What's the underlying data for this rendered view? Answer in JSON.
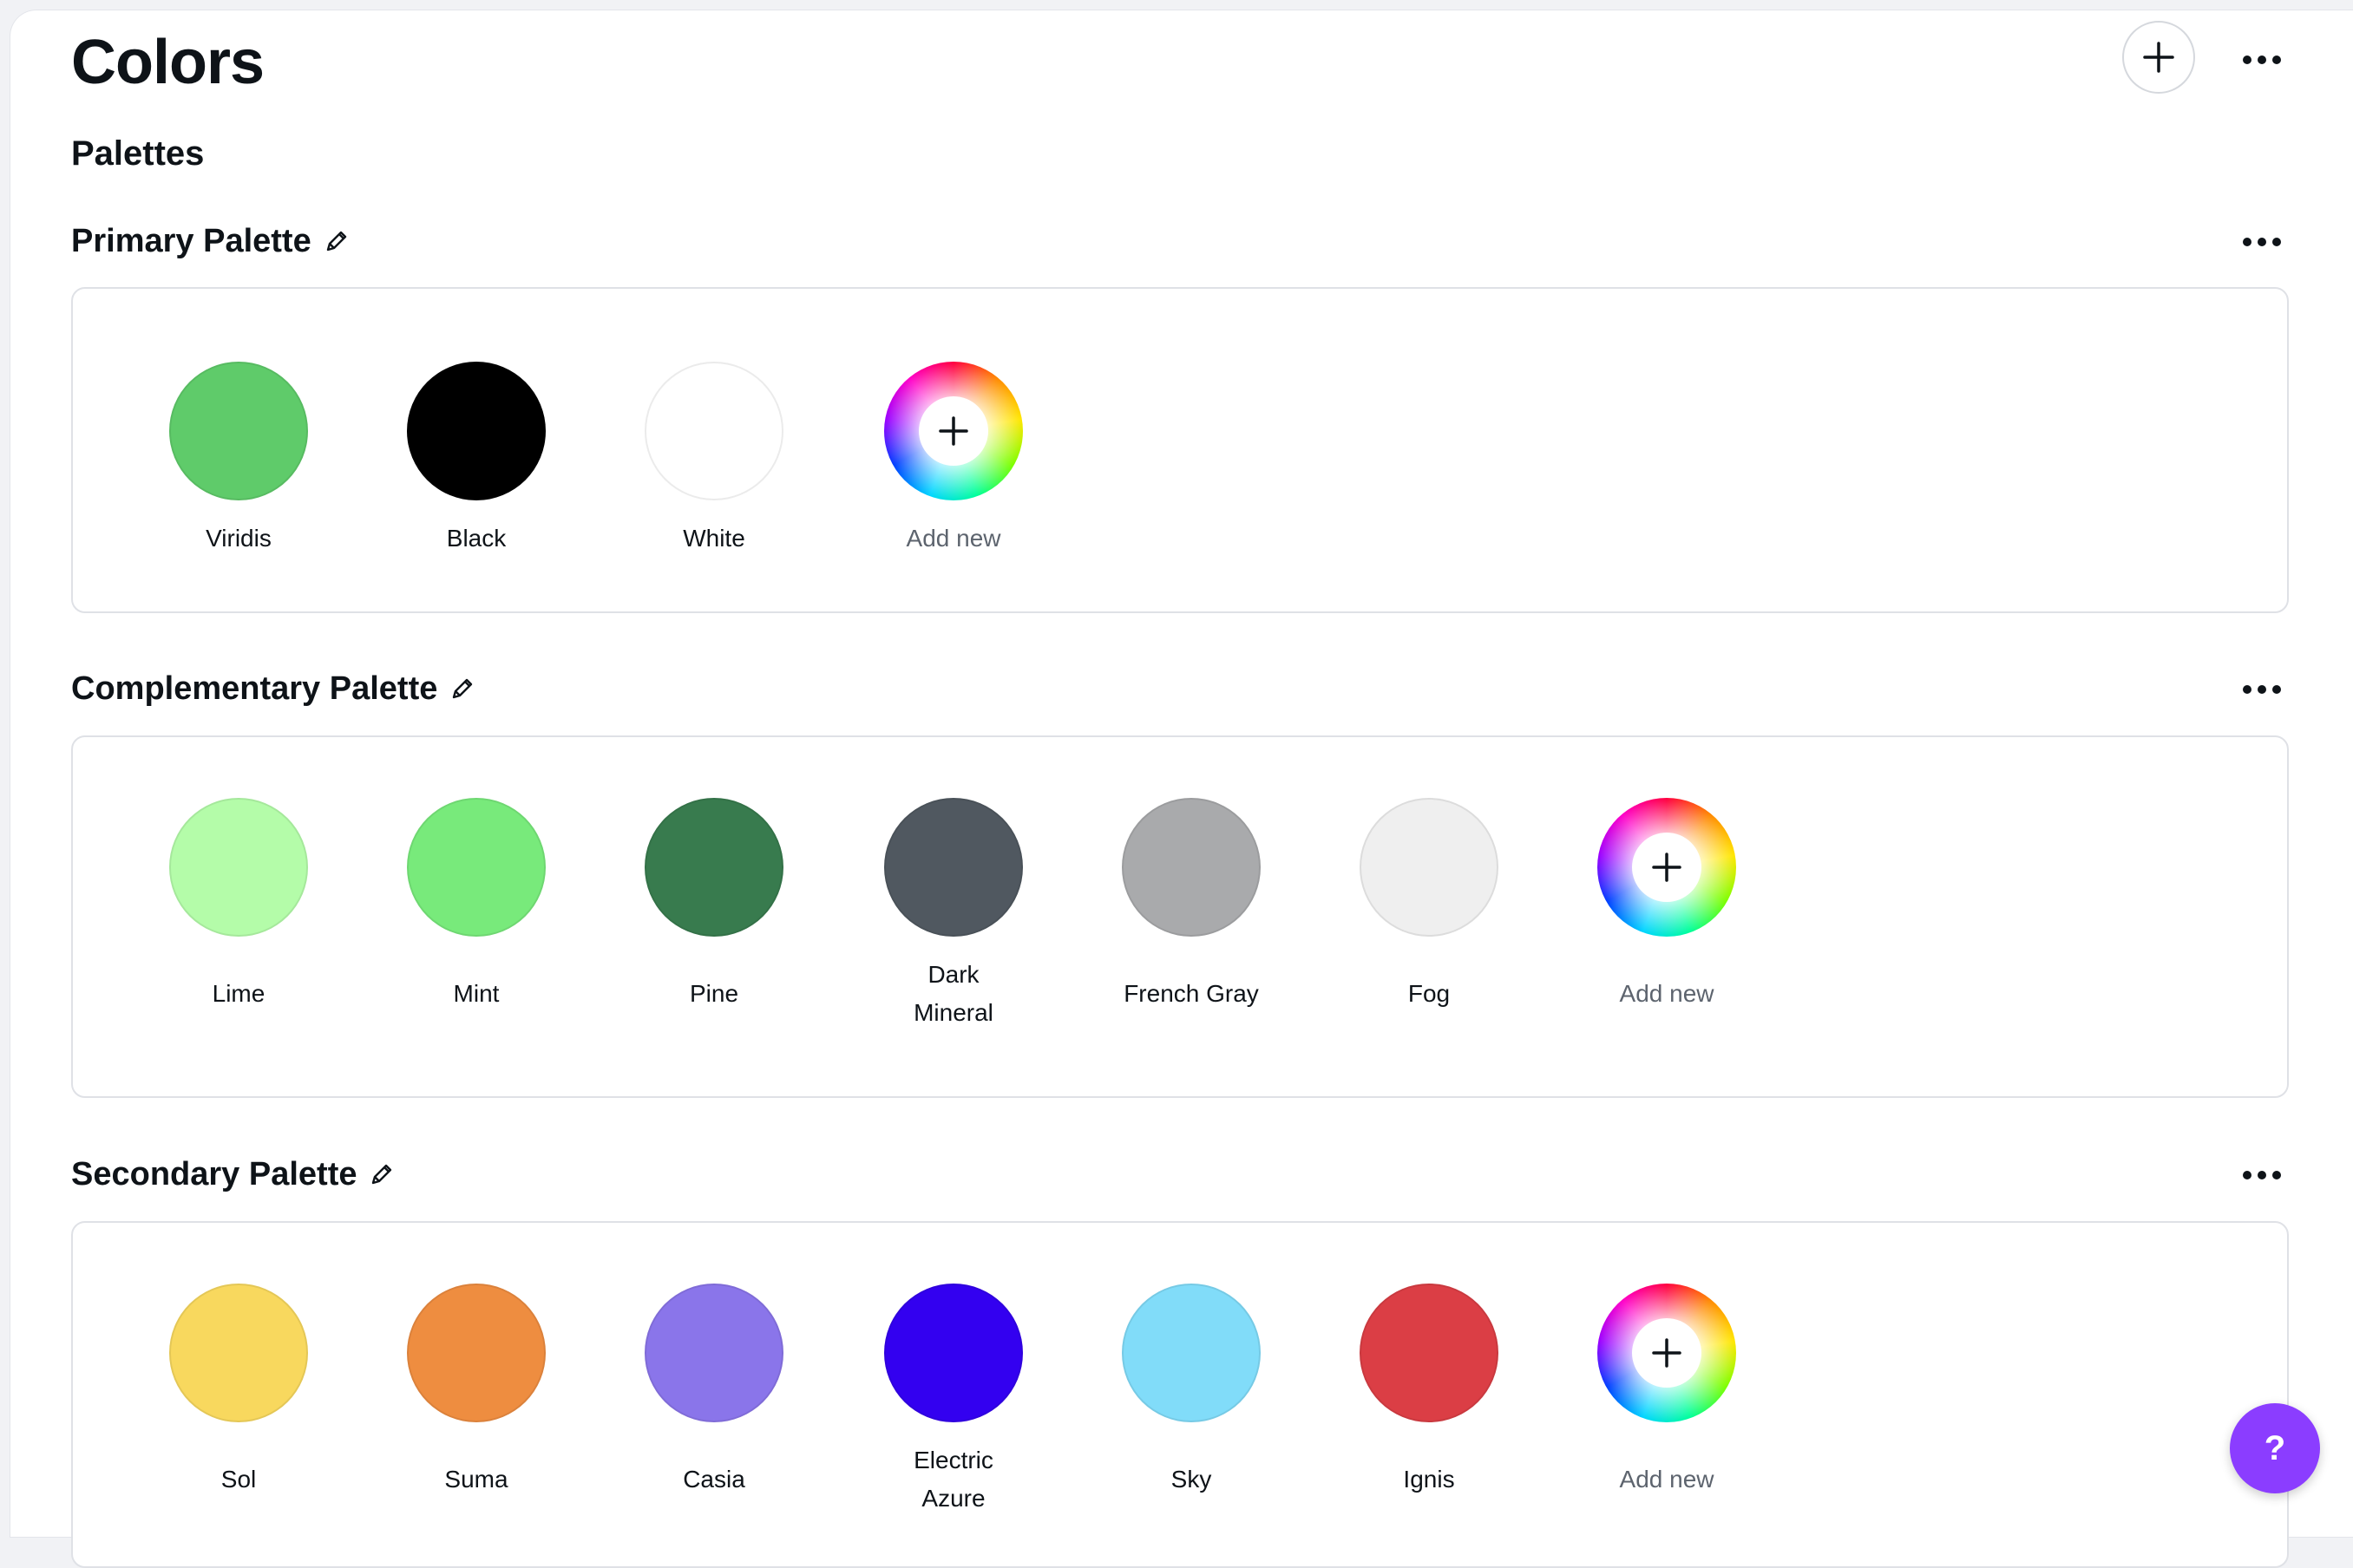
{
  "header": {
    "title": "Colors"
  },
  "section_title": "Palettes",
  "palettes": [
    {
      "name": "Primary Palette",
      "swatches": [
        {
          "name": "Viridis",
          "color": "#5fcb6a"
        },
        {
          "name": "Black",
          "color": "#000000"
        },
        {
          "name": "White",
          "color": "#ffffff"
        }
      ],
      "add_label": "Add new"
    },
    {
      "name": "Complementary Palette",
      "swatches": [
        {
          "name": "Lime",
          "color": "#b4fca9"
        },
        {
          "name": "Mint",
          "color": "#78ea7b"
        },
        {
          "name": "Pine",
          "color": "#387b4e"
        },
        {
          "name": "Dark Mineral",
          "color": "#505860"
        },
        {
          "name": "French Gray",
          "color": "#a9aaac"
        },
        {
          "name": "Fog",
          "color": "#efefef"
        }
      ],
      "add_label": "Add new"
    },
    {
      "name": "Secondary Palette",
      "swatches": [
        {
          "name": "Sol",
          "color": "#f8d85e"
        },
        {
          "name": "Suma",
          "color": "#ee8d40"
        },
        {
          "name": "Casia",
          "color": "#8a75ea"
        },
        {
          "name": "Electric Azure",
          "color": "#3300f0"
        },
        {
          "name": "Sky",
          "color": "#81dcf9"
        },
        {
          "name": "Ignis",
          "color": "#db3e45"
        }
      ],
      "add_label": "Add new"
    }
  ],
  "help_button": {
    "label": "?"
  },
  "theme": {
    "accent": "#8b3dff",
    "border": "#dfe1e6",
    "text": "#0e1318"
  }
}
